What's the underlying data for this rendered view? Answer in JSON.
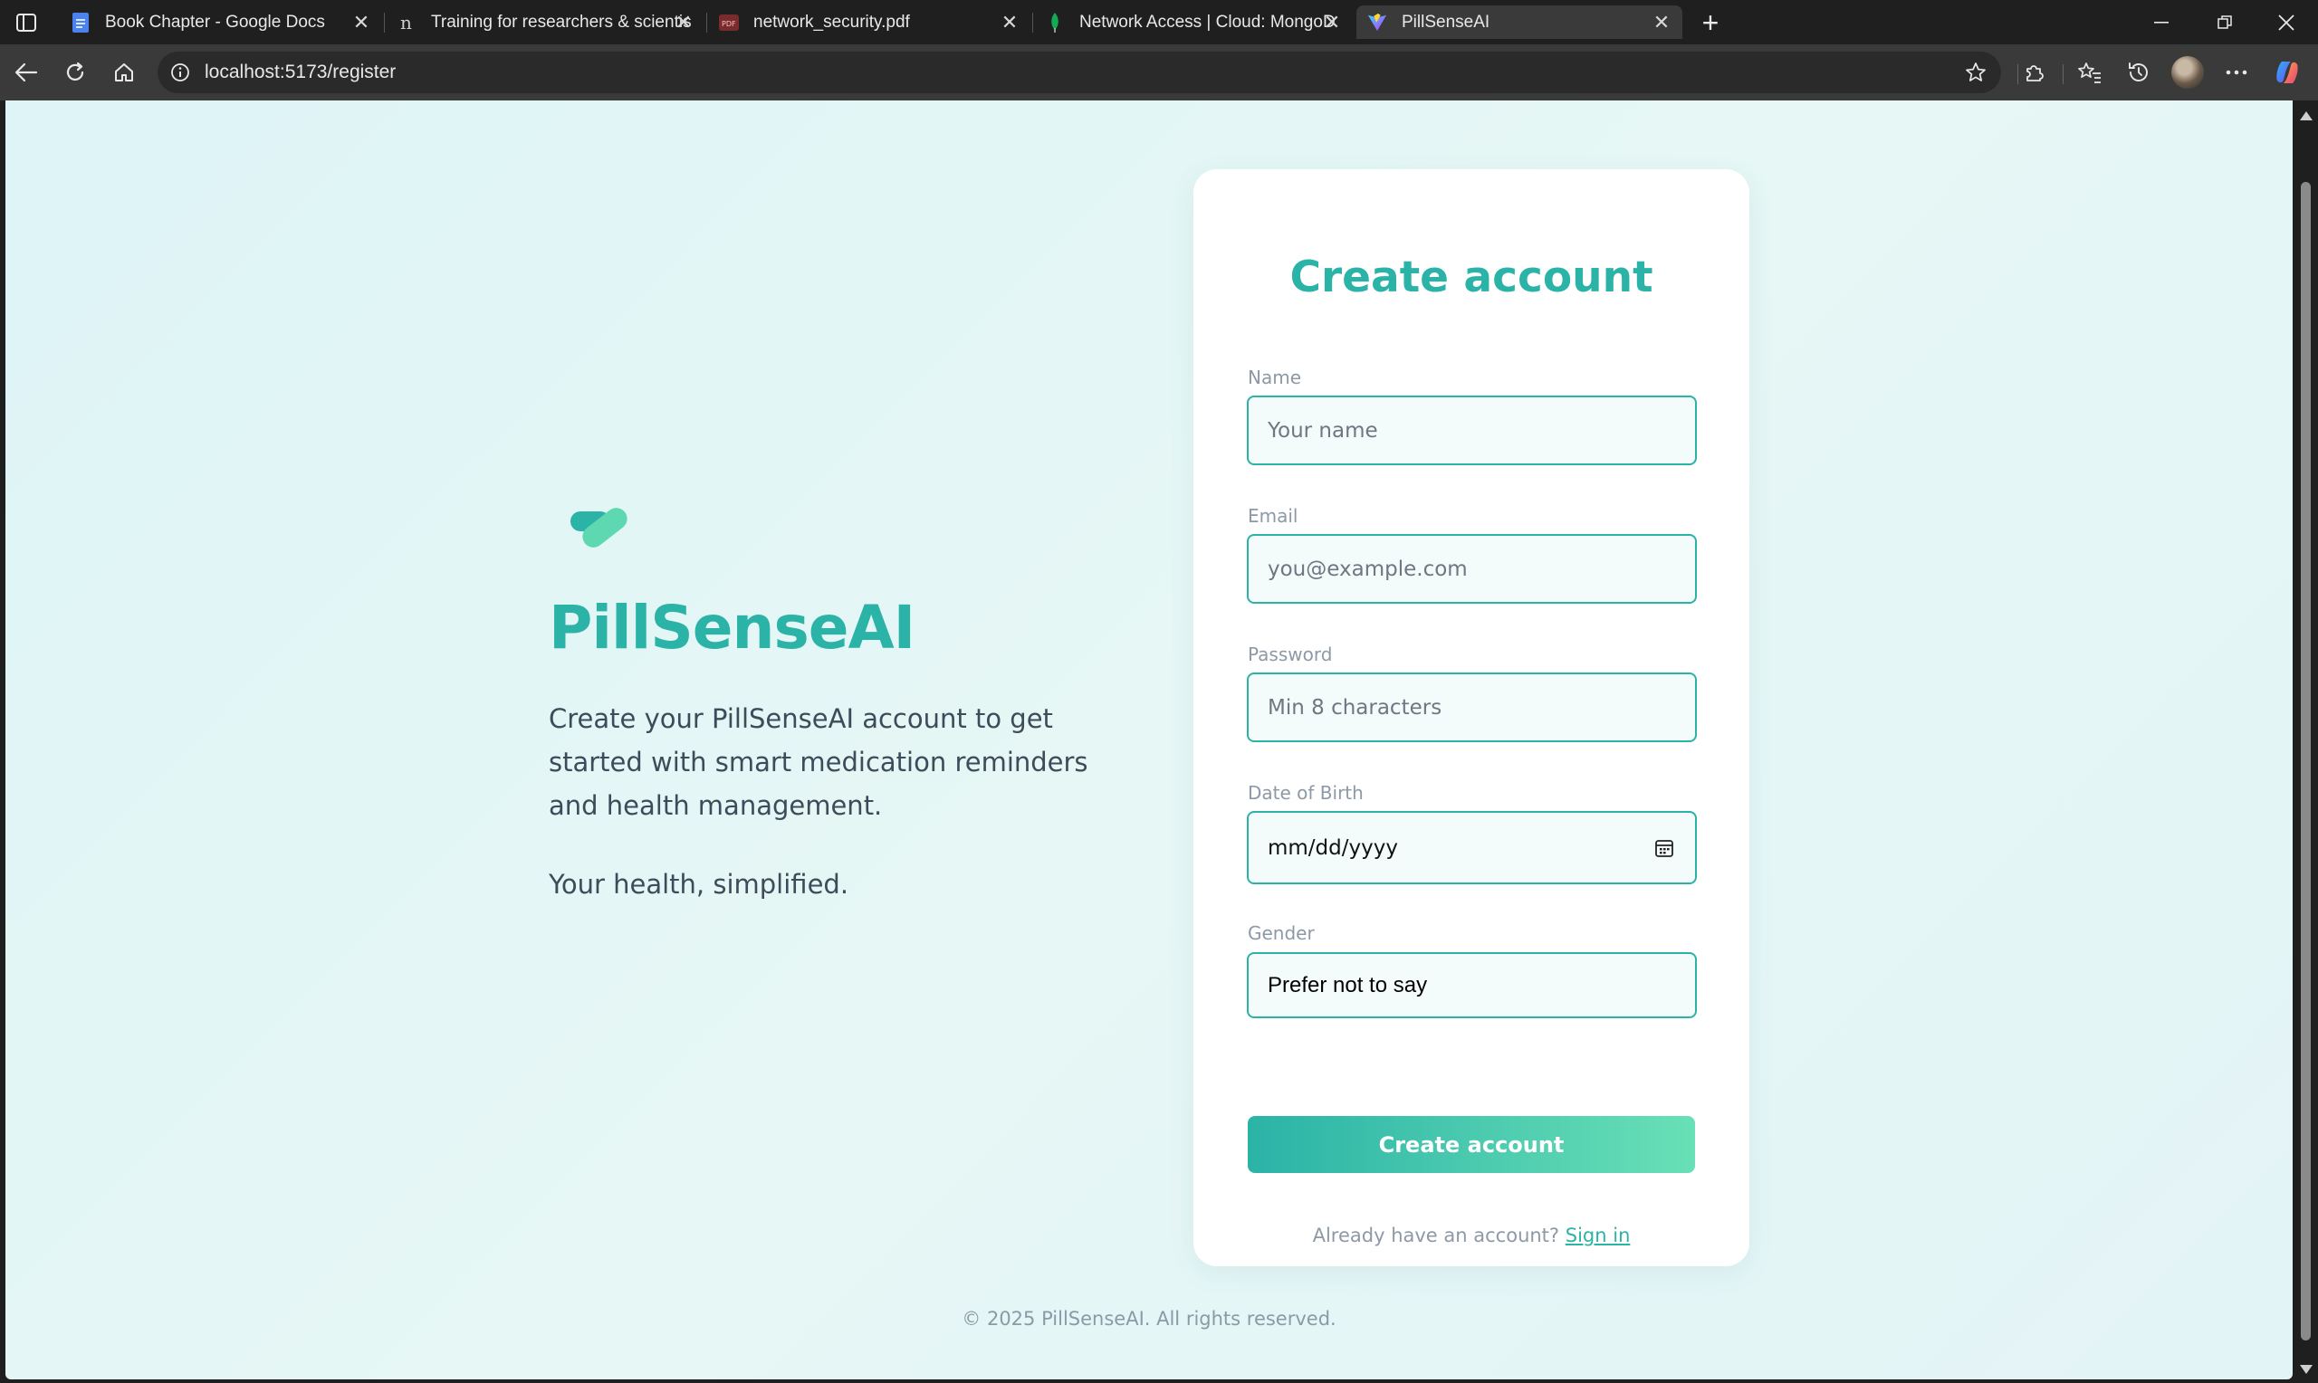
{
  "browser": {
    "tabs": [
      {
        "title": "Book Chapter - Google Docs",
        "icon": "google-docs-icon",
        "color": "#4a82f0"
      },
      {
        "title": "Training for researchers & scientis",
        "icon": "notion-icon",
        "color": "#d0d0d0"
      },
      {
        "title": "network_security.pdf",
        "icon": "pdf-icon",
        "color": "#b03a3a"
      },
      {
        "title": "Network Access | Cloud: MongoD",
        "icon": "mongodb-leaf-icon",
        "color": "#13aa52"
      },
      {
        "title": "PillSenseAI",
        "icon": "vite-icon",
        "color": "#a855f7"
      }
    ],
    "address": "localhost:5173/register"
  },
  "hero": {
    "brand": "PillSenseAI",
    "description": "Create your PillSenseAI account to get started with smart medication reminders and health management.",
    "tagline": "Your health, simplified.",
    "accent_color": "#2bb3a7"
  },
  "form": {
    "title": "Create account",
    "name": {
      "label": "Name",
      "placeholder": "Your name"
    },
    "email": {
      "label": "Email",
      "placeholder": "you@example.com"
    },
    "password": {
      "label": "Password",
      "placeholder": "Min 8 characters"
    },
    "dob": {
      "label": "Date of Birth",
      "value": "mm/dd/yyyy"
    },
    "gender": {
      "label": "Gender",
      "value": "Prefer not to say"
    },
    "submit_label": "Create account",
    "signin_prompt": "Already have an account?",
    "signin_link": "Sign in"
  },
  "footer": {
    "copyright": "© 2025 PillSenseAI. All rights reserved."
  }
}
